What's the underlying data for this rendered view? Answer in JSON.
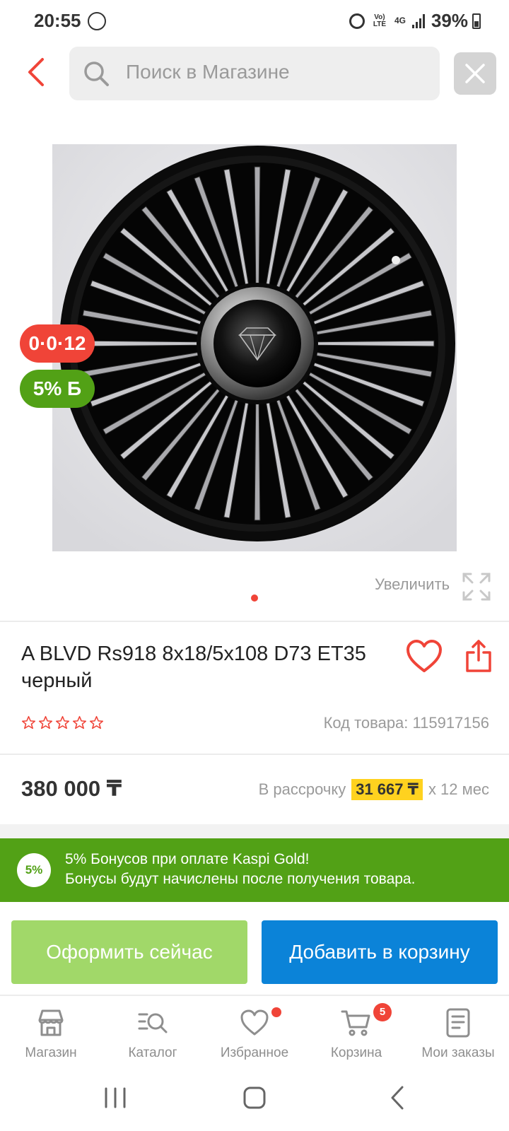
{
  "status_bar": {
    "time": "20:55",
    "lte": "Vo) LTE",
    "network": "4G",
    "battery": "39%"
  },
  "search": {
    "placeholder": "Поиск в Магазине"
  },
  "product": {
    "installment_badge": "0·0·12",
    "bonus_badge": "5% Б",
    "zoom_label": "Увеличить",
    "title": "A BLVD Rs918 8x18/5x108 D73 ET35 черный",
    "rating": 0,
    "sku_label": "Код товара: 115917156",
    "price": "380 000 ₸",
    "installment_prefix": "В рассрочку",
    "installment_amount": "31 667 ₸",
    "installment_suffix": "х 12 мес"
  },
  "bonus_banner": {
    "percent": "5%",
    "line1": "5% Бонусов при оплате Kaspi Gold!",
    "line2": "Бонусы будут начислены после получения товара."
  },
  "actions": {
    "buy_now": "Оформить сейчас",
    "add_to_cart": "Добавить в корзину"
  },
  "nav": {
    "items": [
      {
        "label": "Магазин",
        "icon": "store-icon"
      },
      {
        "label": "Каталог",
        "icon": "catalog-search-icon"
      },
      {
        "label": "Избранное",
        "icon": "heart-icon"
      },
      {
        "label": "Корзина",
        "icon": "cart-icon",
        "badge": "5"
      },
      {
        "label": "Мои заказы",
        "icon": "orders-icon"
      }
    ]
  },
  "colors": {
    "accent_red": "#f04438",
    "kaspi_green": "#52a116",
    "buy_button": "#a1d869",
    "cart_button": "#0b83d8",
    "installment_highlight": "#ffd21f"
  }
}
